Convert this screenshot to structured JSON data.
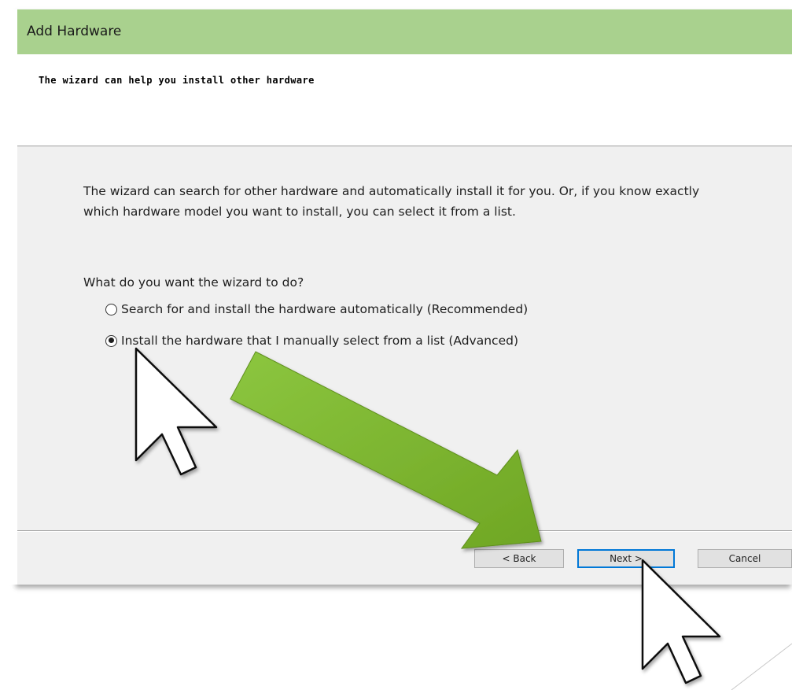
{
  "dialog": {
    "title": "Add Hardware",
    "header_text": "The wizard can help you install other hardware",
    "description": "The wizard can search for other hardware and automatically install it for you. Or, if you know exactly which hardware model you want to install, you can select it from a list.",
    "question": "What do you want the wizard to do?",
    "options": [
      {
        "label": "Search for and install the hardware automatically (Recommended)",
        "selected": false
      },
      {
        "label": "Install the hardware that I manually select from a list (Advanced)",
        "selected": true
      }
    ],
    "buttons": {
      "back": "< Back",
      "next": "Next >",
      "cancel": "Cancel"
    }
  },
  "colors": {
    "title_bar": "#a9d18e",
    "arrow_green": "#7bb32e",
    "focus_blue": "#0078d7"
  },
  "annotations": {
    "arrow_icon": "green-arrow-icon",
    "cursor_icon": "mouse-pointer-icon"
  }
}
